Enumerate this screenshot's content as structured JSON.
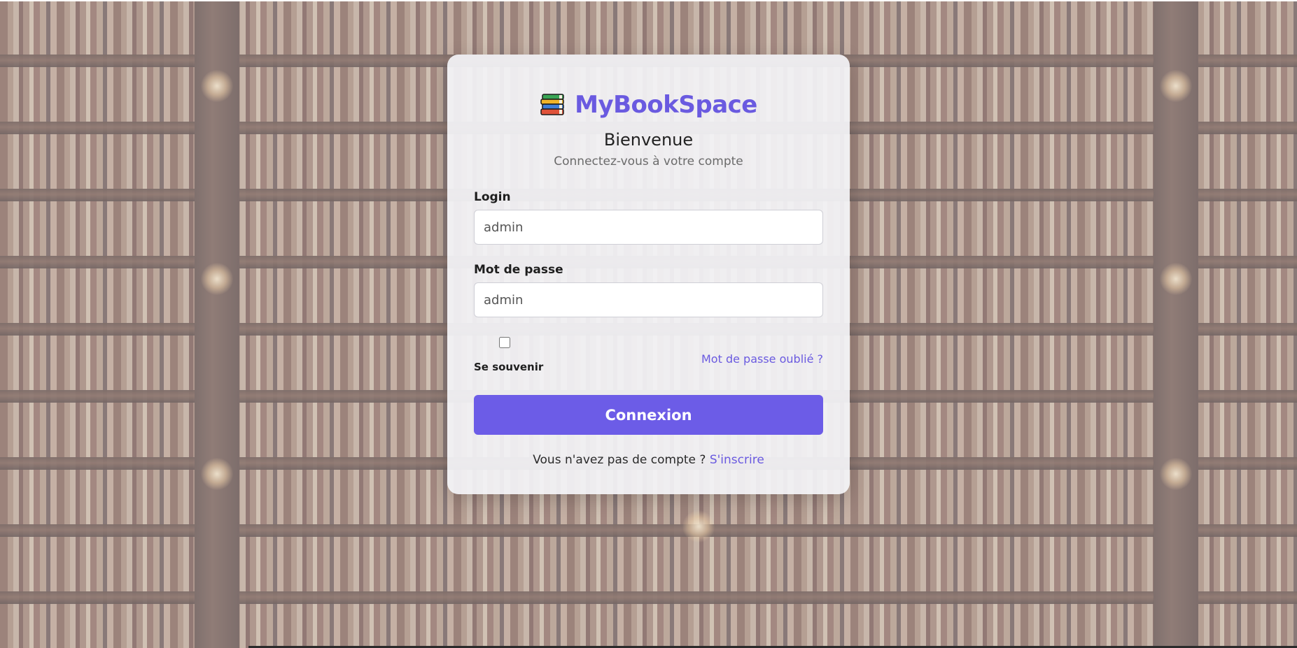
{
  "brand": {
    "name": "MyBookSpace",
    "accent_color": "#6a5ae0",
    "logo_icon": "stacked-books-icon"
  },
  "header": {
    "title": "Bienvenue",
    "subtitle": "Connectez-vous à votre compte"
  },
  "form": {
    "login": {
      "label": "Login",
      "placeholder": "admin",
      "value": ""
    },
    "password": {
      "label": "Mot de passe",
      "placeholder": "admin",
      "value": ""
    },
    "remember": {
      "label": "Se souvenir",
      "checked": false
    },
    "forgot_link": "Mot de passe oublié ?",
    "submit_label": "Connexion",
    "submit_color": "#6c5ce7"
  },
  "footer": {
    "prompt": "Vous n'avez pas de compte ?",
    "signup_link": "S'inscrire"
  },
  "background": {
    "icon": "bookshelf-background"
  }
}
